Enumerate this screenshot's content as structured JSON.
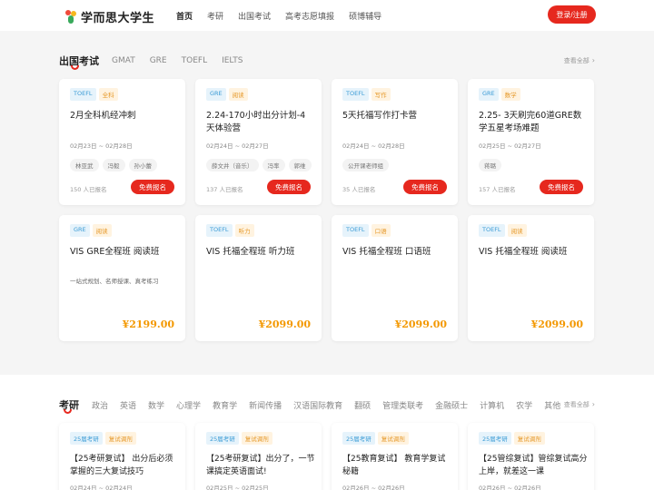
{
  "header": {
    "logo_text": "学而思大学生",
    "nav": [
      "首页",
      "考研",
      "出国考试",
      "高考志愿填报",
      "硕博辅导"
    ],
    "login": "登录/注册"
  },
  "abroad": {
    "title": "出国考试",
    "tabs": [
      "GMAT",
      "GRE",
      "TOEFL",
      "IELTS"
    ],
    "view_all": "查看全部",
    "cards": [
      {
        "tags": [
          "TOEFL",
          "全科"
        ],
        "title": "2月全科机经冲刺",
        "date": "02月23日 ~ 02月28日",
        "teachers": [
          "林亚武",
          "冯毅",
          "孙小蕾"
        ],
        "enrolled": "150 人已报名",
        "btn": "免费报名"
      },
      {
        "tags": [
          "GRE",
          "阅读"
        ],
        "title": "2.24-170小时出分计划-4天体验营",
        "date": "02月24日 ~ 02月27日",
        "teachers": [
          "薛文井（音乐）",
          "冯率",
          "郭维"
        ],
        "enrolled": "137 人已报名",
        "btn": "免费报名"
      },
      {
        "tags": [
          "TOEFL",
          "写作"
        ],
        "title": "5天托福写作打卡营",
        "date": "02月24日 ~ 02月28日",
        "teachers": [
          "公开课老师组"
        ],
        "enrolled": "35 人已报名",
        "btn": "免费报名"
      },
      {
        "tags": [
          "GRE",
          "数学"
        ],
        "title": "2.25- 3天刷完60道GRE数学五星考场难题",
        "date": "02月25日 ~ 02月27日",
        "teachers": [
          "蒋璐"
        ],
        "enrolled": "157 人已报名",
        "btn": "免费报名"
      }
    ],
    "courses": [
      {
        "tags": [
          "GRE",
          "阅读"
        ],
        "title": "VIS GRE全程班 阅读班",
        "desc": "一站式规划、名师授课、真考练习",
        "price": "¥2199.00"
      },
      {
        "tags": [
          "TOEFL",
          "听力"
        ],
        "title": "VIS 托福全程班 听力班",
        "desc": "",
        "price": "¥2099.00"
      },
      {
        "tags": [
          "TOEFL",
          "口语"
        ],
        "title": "VIS 托福全程班 口语班",
        "desc": "",
        "price": "¥2099.00"
      },
      {
        "tags": [
          "TOEFL",
          "阅读"
        ],
        "title": "VIS 托福全程班 阅读班",
        "desc": "",
        "price": "¥2099.00"
      }
    ]
  },
  "kaoyan": {
    "title": "考研",
    "tabs": [
      "政治",
      "英语",
      "数学",
      "心理学",
      "教育学",
      "新闻传播",
      "汉语国际教育",
      "翻硕",
      "管理类联考",
      "金融硕士",
      "计算机",
      "农学",
      "其他"
    ],
    "view_all": "查看全部",
    "cards": [
      {
        "tags": [
          "25届考研",
          "复试调剂"
        ],
        "title": "【25考研复试】 出分后必须掌握的三大复试技巧",
        "date": "02月24日 ~ 02月24日"
      },
      {
        "tags": [
          "25届考研",
          "复试调剂"
        ],
        "title": "【25考研复试】出分了，一节课搞定英语面试!",
        "date": "02月25日 ~ 02月25日"
      },
      {
        "tags": [
          "25届考研",
          "复试调剂"
        ],
        "title": "【25教育复试】 教育学复试秘籍",
        "date": "02月26日 ~ 02月26日"
      },
      {
        "tags": [
          "25届考研",
          "复试调剂"
        ],
        "title": "【25管综复试】管综复试高分上岸，就差这一课",
        "date": "02月26日 ~ 02月26日"
      }
    ]
  },
  "colors": {
    "accent": "#e6281e",
    "price": "#f39800",
    "tag_blue": "#3a9bd5",
    "tag_orange": "#e59726"
  }
}
